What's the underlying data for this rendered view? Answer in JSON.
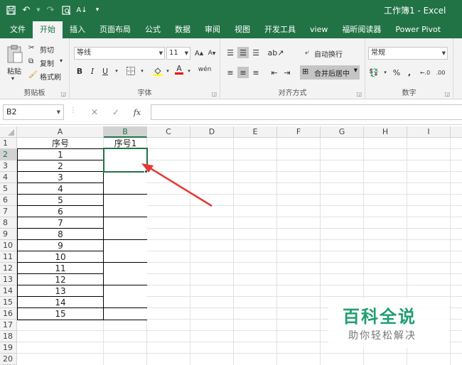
{
  "window": {
    "title": "工作簿1  -  Excel"
  },
  "qat": {
    "save_icon": "save-icon",
    "undo_icon": "undo-icon",
    "redo_icon": "redo-icon"
  },
  "tabs": [
    "文件",
    "开始",
    "插入",
    "页面布局",
    "公式",
    "数据",
    "审阅",
    "视图",
    "开发工具",
    "view",
    "福昕阅读器",
    "Power Pivot"
  ],
  "active_tab": "开始",
  "ribbon": {
    "clipboard": {
      "paste": "粘贴",
      "cut": "剪切",
      "copy": "复制",
      "format_painter": "格式刷",
      "label": "剪贴板"
    },
    "font": {
      "font_name": "等线",
      "font_size": "11",
      "bold": "B",
      "italic": "I",
      "underline": "U",
      "label": "字体"
    },
    "alignment": {
      "wrap": "自动换行",
      "merge": "合并后居中",
      "label": "对齐方式"
    },
    "number": {
      "format": "常规",
      "percent": "%",
      "comma": ",",
      "label": "数字"
    }
  },
  "formula_bar": {
    "name_box": "B2",
    "fx": "fx",
    "formula": ""
  },
  "columns": [
    "A",
    "B",
    "C",
    "D",
    "E",
    "F",
    "G",
    "H",
    "I"
  ],
  "rows": [
    "1",
    "2",
    "3",
    "4",
    "5",
    "6",
    "7",
    "8",
    "9",
    "10",
    "11",
    "12",
    "13",
    "14",
    "15",
    "16",
    "17",
    "18",
    "19",
    "20"
  ],
  "sheet": {
    "a1": "序号",
    "b1": "序号1",
    "a_values": [
      "1",
      "2",
      "3",
      "4",
      "5",
      "6",
      "7",
      "8",
      "9",
      "10",
      "11",
      "12",
      "13",
      "14",
      "15"
    ]
  },
  "selected_cell": "B2",
  "watermark": {
    "main": "百科全说",
    "sub": "助你轻松解决"
  },
  "colors": {
    "excel_green": "#217346",
    "arrow": "#e53935"
  }
}
